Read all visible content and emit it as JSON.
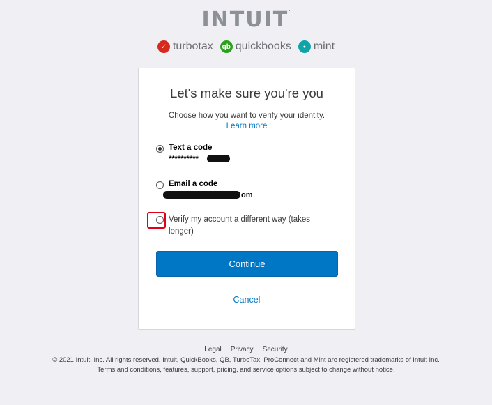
{
  "header": {
    "logo_text": "INTUIT",
    "brands": [
      {
        "name": "turbotax",
        "icon": "check-icon",
        "color": "#d52b1e",
        "glyph": "✓"
      },
      {
        "name": "quickbooks",
        "icon": "qb-icon",
        "color": "#2ca01c",
        "glyph": "qb"
      },
      {
        "name": "mint",
        "icon": "mint-leaf-icon",
        "color": "#10a3a8",
        "glyph": "●"
      }
    ]
  },
  "card": {
    "title": "Let's make sure you're you",
    "subtitle": "Choose how you want to verify your identity.",
    "learn_more": "Learn more",
    "options": [
      {
        "title": "Text a code",
        "value": "**********",
        "checked": true
      },
      {
        "title": "Email a code",
        "value": "om",
        "checked": false
      },
      {
        "text": "Verify my account a different way (takes longer)",
        "checked": false
      }
    ],
    "continue_label": "Continue",
    "cancel_label": "Cancel"
  },
  "footer": {
    "links": [
      "Legal",
      "Privacy",
      "Security"
    ],
    "copyright": "© 2021 Intuit, Inc. All rights reserved. Intuit, QuickBooks, QB, TurboTax, ProConnect and Mint are registered trademarks of Intuit Inc.",
    "terms": "Terms and conditions, features, support, pricing, and service options subject to change without notice."
  },
  "colors": {
    "accent": "#0077c5",
    "background": "#f0f0f4",
    "annotation": "#e1001a"
  }
}
